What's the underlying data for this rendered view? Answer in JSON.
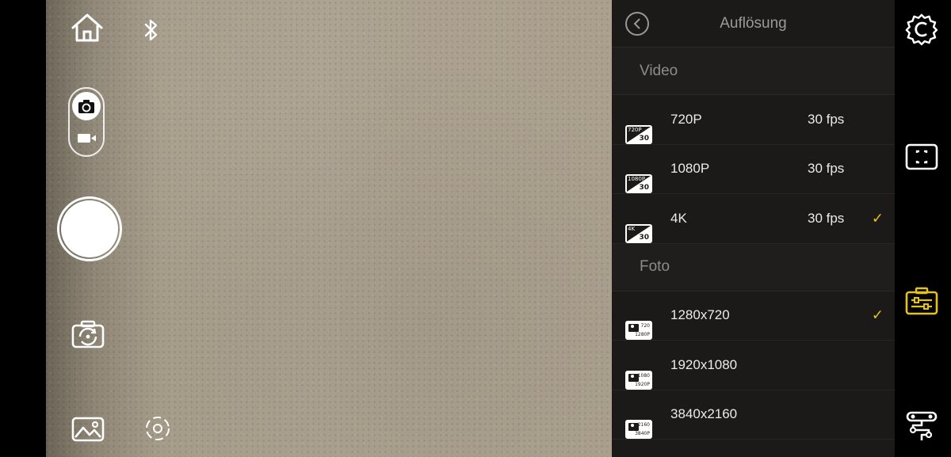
{
  "panel": {
    "title": "Auflösung",
    "back_icon": "chevron-left-icon",
    "sections": [
      {
        "label": "Video",
        "rows": [
          {
            "label": "720P",
            "fps": "30 fps",
            "badge_top": "720P",
            "badge_bottom": "30",
            "selected": false
          },
          {
            "label": "1080P",
            "fps": "30 fps",
            "badge_top": "1080P",
            "badge_bottom": "30",
            "selected": false
          },
          {
            "label": "4K",
            "fps": "30 fps",
            "badge_top": "4K",
            "badge_bottom": "30",
            "selected": true
          }
        ]
      },
      {
        "label": "Foto",
        "rows": [
          {
            "label": "1280x720",
            "badge_top": "720",
            "badge_bottom": "1280P",
            "selected": true
          },
          {
            "label": "1920x1080",
            "badge_top": "1080",
            "badge_bottom": "1920P",
            "selected": false
          },
          {
            "label": "3840x2160",
            "badge_top": "2160",
            "badge_bottom": "3840P",
            "selected": false
          }
        ]
      }
    ],
    "check_glyph": "✓"
  },
  "left_controls": {
    "home_icon": "home-icon",
    "bluetooth_icon": "bluetooth-icon",
    "mode_photo_icon": "camera-rotate-icon",
    "mode_video_icon": "video-camera-icon",
    "shutter": "shutter-button",
    "flip_camera_icon": "camera-flip-icon",
    "gallery_icon": "gallery-icon",
    "tracking_icon": "tracking-icon"
  },
  "right_rail": {
    "items": [
      "settings-gear-icon",
      "frame-icon",
      "toolbox-icon",
      "gimbal-settings-icon"
    ],
    "active": "toolbox-icon"
  },
  "colors": {
    "accent": "#E6C215",
    "panel_bg": "#1B1A19",
    "text": "#ECEBE8",
    "muted_text": "#8E8C88"
  }
}
